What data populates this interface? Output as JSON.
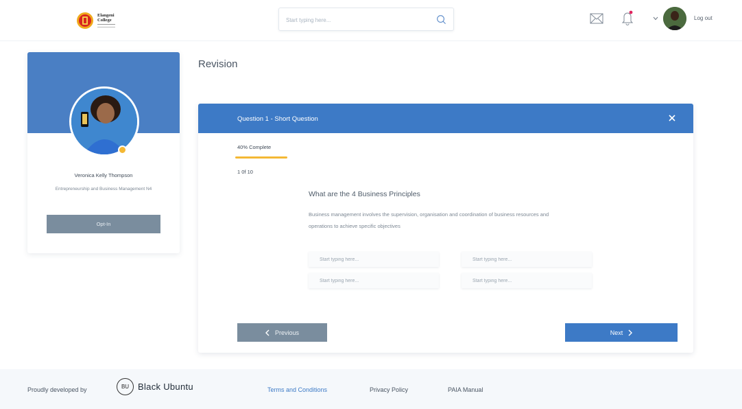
{
  "header": {
    "logo_line1": "Elangeni",
    "logo_line2": "College",
    "search_placeholder": "Start typing here...",
    "logout_label": "Log out"
  },
  "profile": {
    "name": "Veronica Kelly Thompson",
    "course": "Entrepreneurship and Business Management N4",
    "optin_label": "Opt-In",
    "status_color": "#f4b834"
  },
  "main": {
    "page_title": "Revision",
    "quiz": {
      "title": "Question 1 - Short Question",
      "progress_label": "40% Complete",
      "progress_fraction": 0.4,
      "counter": "1 0f 10",
      "question": "What are the 4 Business Principles",
      "description": "Business management involves the supervision, organisation and coordination of business resources and operations to achieve specific objectives",
      "answers": [
        {
          "placeholder": "Start typing here..."
        },
        {
          "placeholder": "Start typing here..."
        },
        {
          "placeholder": "Start typing here..."
        },
        {
          "placeholder": "Start typing here..."
        }
      ],
      "prev_label": "Previous",
      "next_label": "Next"
    }
  },
  "footer": {
    "developed_by": "Proudly developed by",
    "brand_initials": "BU",
    "brand_name": "Black Ubuntu",
    "links": [
      "Terms and Conditions",
      "Privacy Policy",
      "PAIA Manual"
    ]
  },
  "colors": {
    "accent": "#3d7ac6",
    "banner": "#4a7fc4",
    "progress": "#f4b834",
    "muted_button": "#7a8d9e"
  }
}
